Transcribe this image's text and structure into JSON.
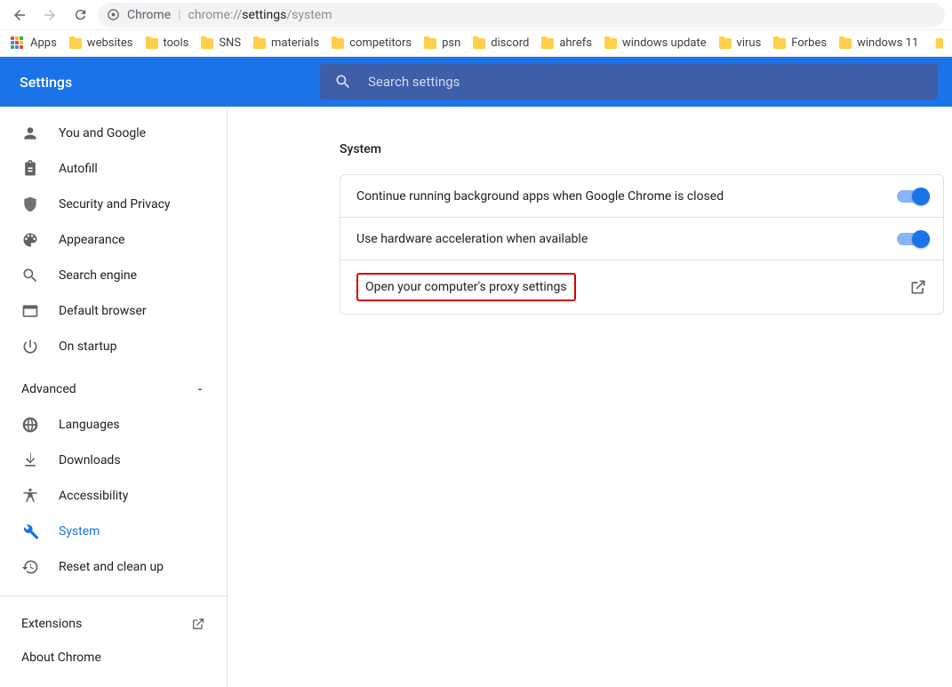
{
  "address_bar": {
    "origin": "Chrome",
    "url_prefix": "chrome://",
    "url_bold": "settings",
    "url_suffix": "/system"
  },
  "bookmarks": {
    "apps_label": "Apps",
    "items": [
      "websites",
      "tools",
      "SNS",
      "materials",
      "competitors",
      "psn",
      "discord",
      "ahrefs",
      "windows update",
      "virus",
      "Forbes",
      "windows 11"
    ]
  },
  "header": {
    "title": "Settings",
    "search_placeholder": "Search settings"
  },
  "sidebar": {
    "items": [
      {
        "id": "you-and-google",
        "label": "You and Google"
      },
      {
        "id": "autofill",
        "label": "Autofill"
      },
      {
        "id": "security-and-privacy",
        "label": "Security and Privacy"
      },
      {
        "id": "appearance",
        "label": "Appearance"
      },
      {
        "id": "search-engine",
        "label": "Search engine"
      },
      {
        "id": "default-browser",
        "label": "Default browser"
      },
      {
        "id": "on-startup",
        "label": "On startup"
      }
    ],
    "advanced_label": "Advanced",
    "advanced_items": [
      {
        "id": "languages",
        "label": "Languages"
      },
      {
        "id": "downloads",
        "label": "Downloads"
      },
      {
        "id": "accessibility",
        "label": "Accessibility"
      },
      {
        "id": "system",
        "label": "System",
        "selected": true
      },
      {
        "id": "reset",
        "label": "Reset and clean up"
      }
    ],
    "extensions_label": "Extensions",
    "about_label": "About Chrome"
  },
  "content": {
    "section_title": "System",
    "rows": [
      {
        "label": "Continue running background apps when Google Chrome is closed",
        "toggle": true
      },
      {
        "label": "Use hardware acceleration when available",
        "toggle": true
      },
      {
        "label": "Open your computer's proxy settings",
        "external": true,
        "highlight": true
      }
    ]
  }
}
